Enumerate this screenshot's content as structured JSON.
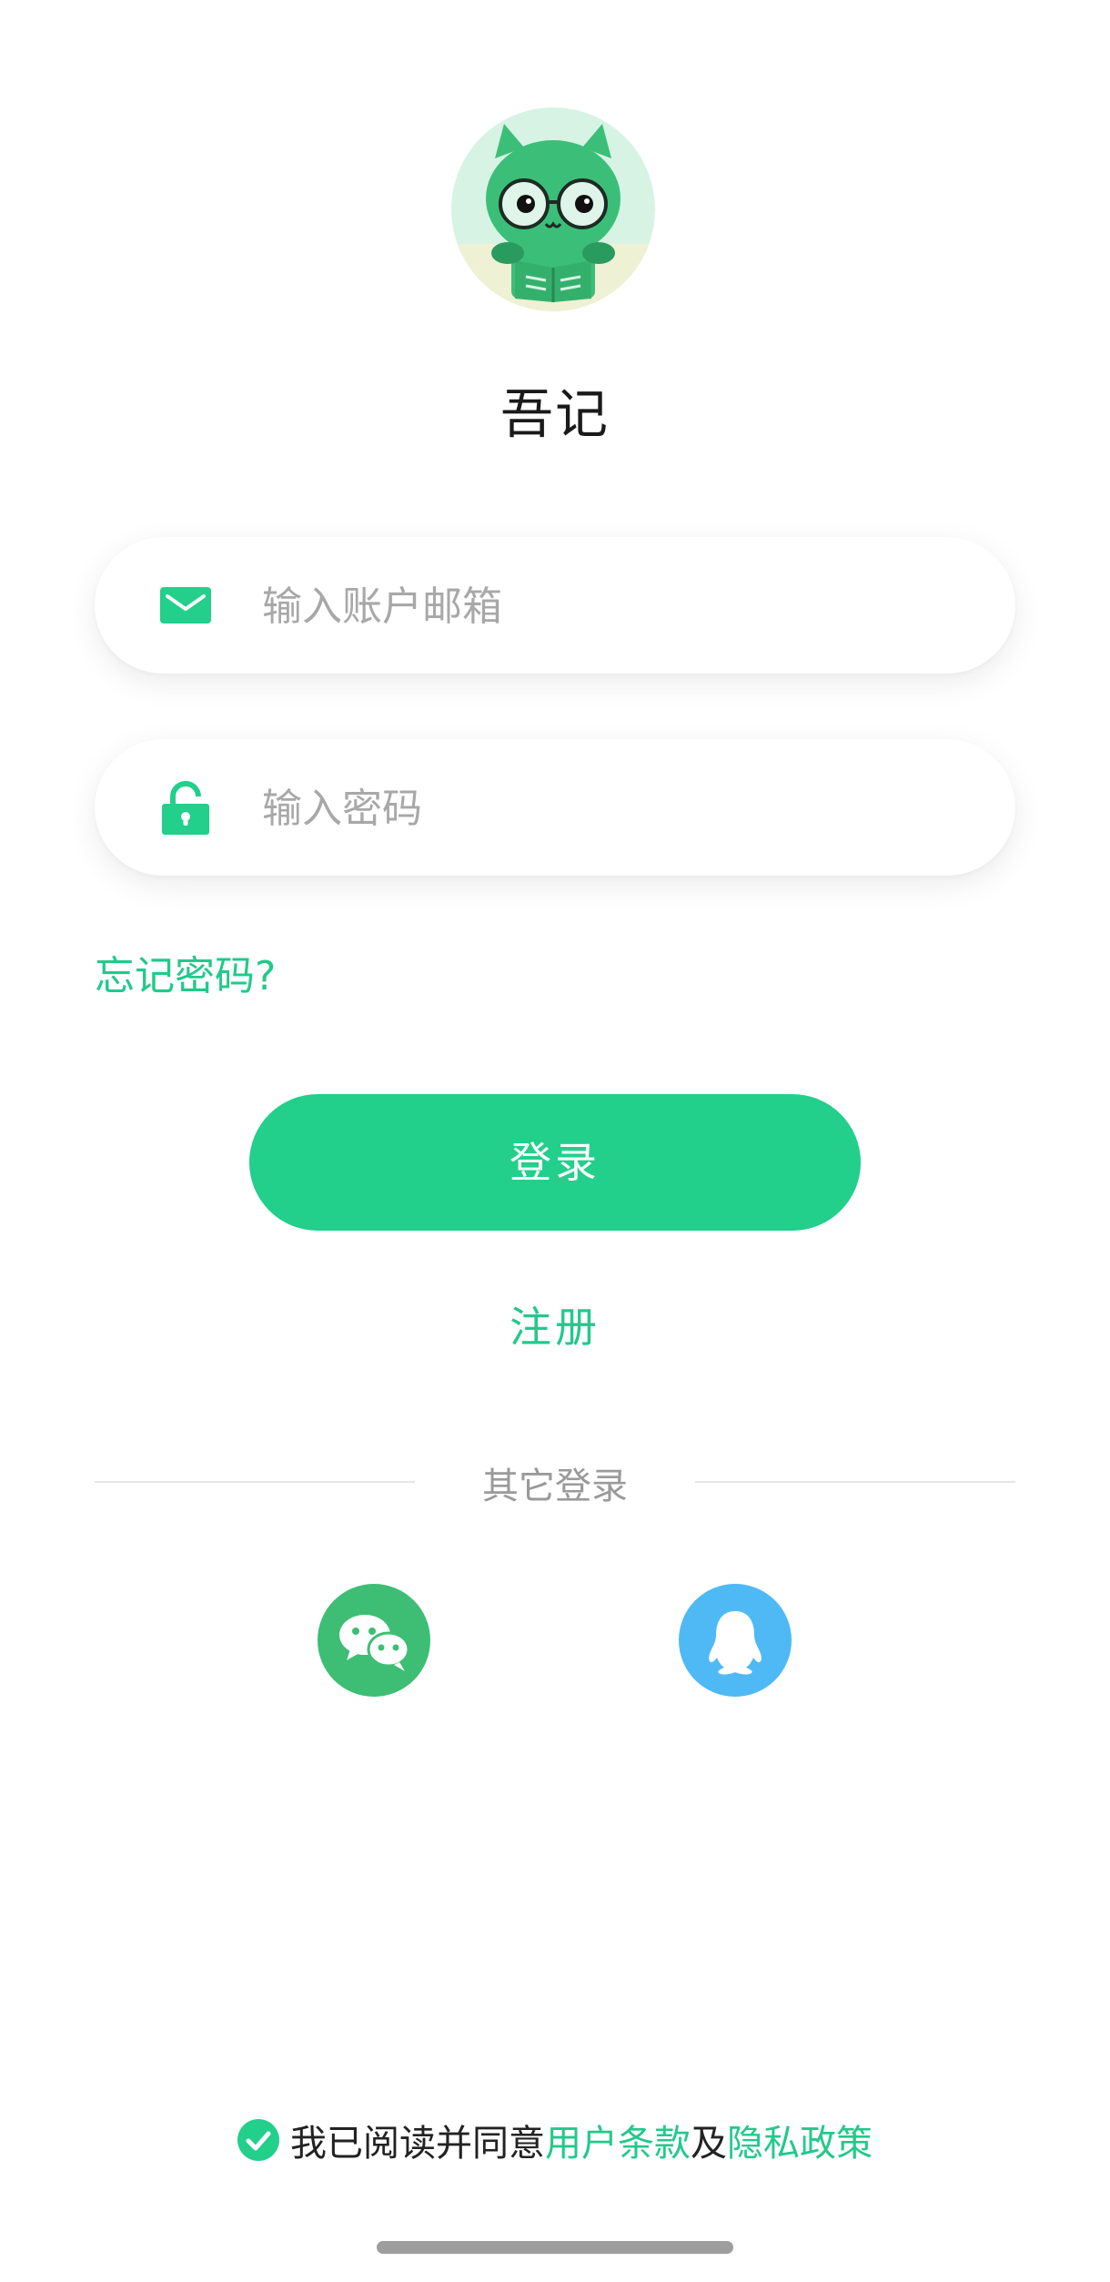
{
  "app": {
    "title": "吾记"
  },
  "login_form": {
    "email": {
      "placeholder": "输入账户邮箱",
      "value": "",
      "icon": "mail-icon"
    },
    "password": {
      "placeholder": "输入密码",
      "value": "",
      "icon": "lock-icon"
    },
    "forgot_password": "忘记密码?",
    "login_label": "登录",
    "register_label": "注册"
  },
  "other_login": {
    "label": "其它登录",
    "providers": [
      {
        "name": "wechat",
        "icon": "wechat-icon",
        "color": "#3dbe74"
      },
      {
        "name": "qq",
        "icon": "qq-icon",
        "color": "#4fb9f6"
      }
    ]
  },
  "agreement": {
    "checked": true,
    "prefix": "我已阅读并同意",
    "terms_link": "用户条款",
    "conjunction": "及",
    "privacy_link": "隐私政策"
  },
  "colors": {
    "accent": "#22cf8b",
    "link": "#22c98a",
    "placeholder": "#a8a8a8",
    "muted": "#9a9a9a"
  }
}
